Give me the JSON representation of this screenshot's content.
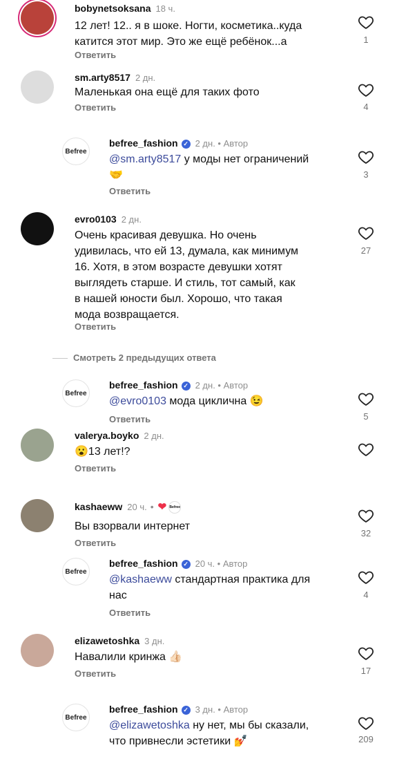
{
  "comments": [
    {
      "user": "bobynetsoksana",
      "time": "18 ч.",
      "text": "12 лет! 12.. я в шоке. Ногти, косметика..куда\nкатится этот мир. Это же ещё ребёнок...а",
      "reply": "Ответить",
      "likes": "1"
    },
    {
      "user": "sm.arty8517",
      "time": "2 дн.",
      "text": "Маленькая она ещё для таких фото",
      "reply": "Ответить",
      "likes": "4"
    },
    {
      "user": "befree_fashion",
      "time": "2 дн.",
      "author": "Автор",
      "mention": "@sm.arty8517",
      "text": " у моды нет ограничений",
      "emoji": "🤝",
      "reply": "Ответить",
      "likes": "3",
      "avatar": "Befree"
    },
    {
      "user": "evro0103",
      "time": "2 дн.",
      "text": "Очень красивая девушка. Но очень\nудивилась, что ей 13, думала,  как минимум\n16.  Хотя, в этом возрасте девушки хотят\nвыглядеть  старше.  И стиль, тот самый, как\nв нашей юности был.  Хорошо, что такая\nмода возвращается.",
      "reply": "Ответить",
      "likes": "27"
    },
    {
      "user": "befree_fashion",
      "time": "2 дн.",
      "author": "Автор",
      "mention": "@evro0103",
      "text": " мода циклична 😉",
      "reply": "Ответить",
      "likes": "5",
      "avatar": "Befree"
    },
    {
      "user": "valerya.boyko",
      "time": "2 дн.",
      "text": "😮13 лет!?",
      "reply": "Ответить",
      "likes": ""
    },
    {
      "user": "kashaeww",
      "time": "20 ч.",
      "text": "Вы взорвали интернет",
      "reply": "Ответить",
      "likes": "32",
      "liked_by_author": "Befree"
    },
    {
      "user": "befree_fashion",
      "time": "20 ч.",
      "author": "Автор",
      "mention": "@kashaeww",
      "text": " стандартная практика для\nнас",
      "reply": "Ответить",
      "likes": "4",
      "avatar": "Befree"
    },
    {
      "user": "elizawetoshka",
      "time": "3 дн.",
      "text": "Навалили кринжа 👍🏻",
      "reply": "Ответить",
      "likes": "17"
    },
    {
      "user": "befree_fashion",
      "time": "3 дн.",
      "author": "Автор",
      "mention": "@elizawetoshka",
      "text": " ну нет, мы бы сказали,\nчто привнесли эстетики 💅",
      "reply": "",
      "likes": "209",
      "avatar": "Befree"
    }
  ],
  "view_previous": "Смотреть 2 предыдущих ответа",
  "colors": {
    "mention": "#3c4b9b",
    "heart_red": "#ed3049",
    "verified": "#3a63d7"
  }
}
